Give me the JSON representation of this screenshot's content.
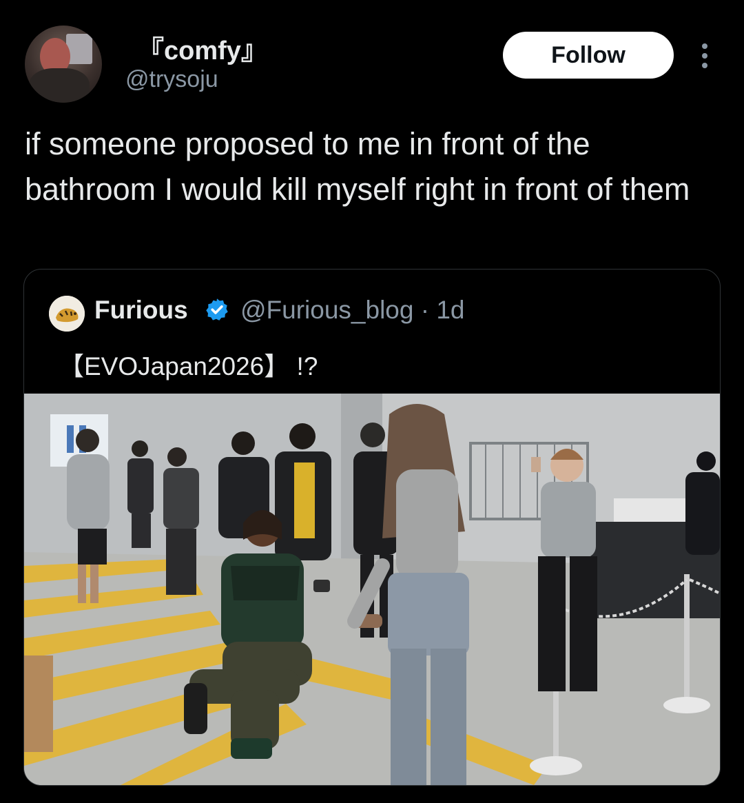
{
  "author": {
    "display_name": "『comfy』",
    "handle": "@trysoju"
  },
  "follow_label": "Follow",
  "tweet_text": "if someone proposed to me in front of the bathroom I would kill myself right in front of them",
  "quoted": {
    "name": "Furious",
    "handle_time": "@Furious_blog · 1d",
    "text": "【EVOJapan2026】 !?"
  },
  "icons": {
    "more": "more-vertical-icon",
    "verified": "verified-badge-icon"
  },
  "colors": {
    "background": "#000000",
    "text": "#e7e9ea",
    "secondary_text": "#8b98a5",
    "verified": "#1d9bf0",
    "follow_bg": "#ffffff"
  }
}
